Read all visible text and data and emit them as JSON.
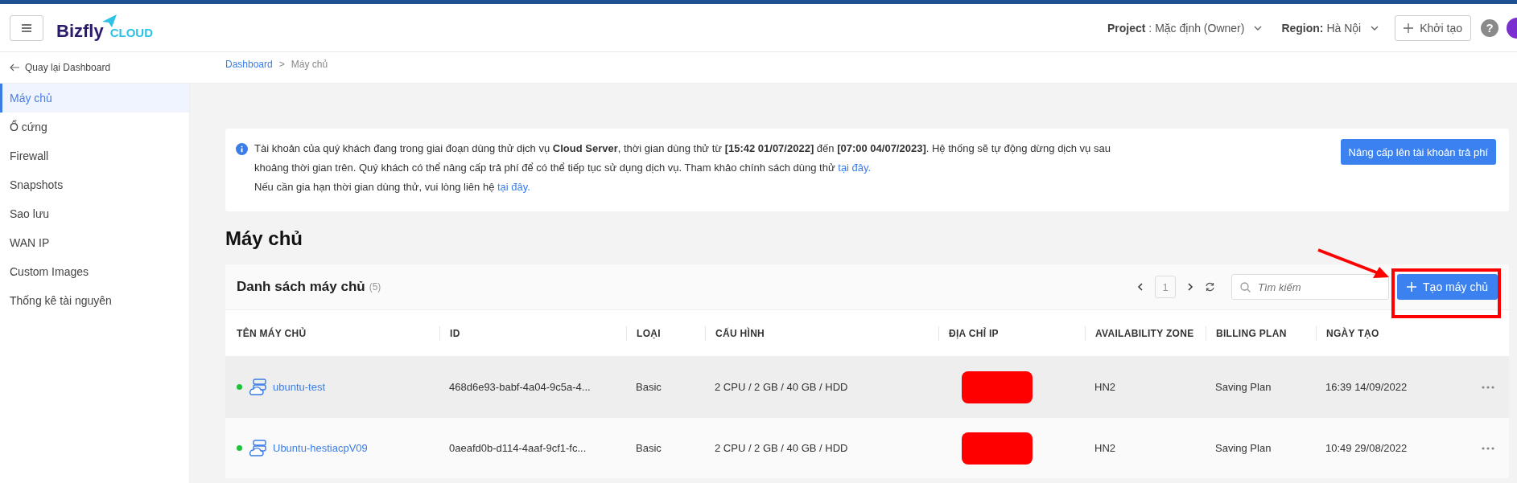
{
  "header": {
    "logo": {
      "name": "Bizfly",
      "suffix": "CLOUD"
    },
    "project_label": "Project",
    "project_value": ": Mặc định (Owner)",
    "region_label": "Region:",
    "region_value": "Hà Nội",
    "create_button": "Khởi tạo",
    "help": "?"
  },
  "sidebar": {
    "back_link": "Quay lại Dashboard",
    "items": [
      {
        "label": "Máy chủ",
        "selected": true
      },
      {
        "label": "Ổ cứng",
        "selected": false
      },
      {
        "label": "Firewall",
        "selected": false
      },
      {
        "label": "Snapshots",
        "selected": false
      },
      {
        "label": "Sao lưu",
        "selected": false
      },
      {
        "label": "WAN IP",
        "selected": false
      },
      {
        "label": "Custom Images",
        "selected": false
      },
      {
        "label": "Thống kê tài nguyên",
        "selected": false
      }
    ]
  },
  "breadcrumb": {
    "items": [
      "Dashboard",
      "Máy chủ"
    ],
    "separator": ">"
  },
  "alert": {
    "paragraphs": [
      {
        "text": "Tài khoản của quý khách đang trong giai đoạn dùng thử dịch vụ **Cloud Server**, thời gian dùng thử từ **[15:42 01/07/2022]** đến **[07:00 04/07/2023]**. Hệ thống sẽ tự động dừng dịch vụ sau khoảng thời gian trên. Quý khách có thể nâng cấp trả phí để có thể tiếp tục sử dụng dịch vụ. Tham khảo chính sách dùng thử ",
        "link": "tại đây."
      },
      {
        "text": "Nếu cần gia hạn thời gian dùng thử, vui lòng liên hệ ",
        "link": "tại đây."
      }
    ],
    "button": "Nâng cấp lên tài khoản trả phí"
  },
  "page_title": "Máy chủ",
  "server_list": {
    "title": "Danh sách máy chủ",
    "count": "(5)",
    "page": "1",
    "search": {
      "placeholder": "Tìm kiếm"
    },
    "create_button": "Tạo máy chủ",
    "columns": [
      "TÊN MÁY CHỦ",
      "ID",
      "LOẠI",
      "CẤU HÌNH",
      "ĐỊA CHỈ IP",
      "AVAILABILITY ZONE",
      "BILLING PLAN",
      "NGÀY TẠO"
    ],
    "rows": [
      {
        "selected": true,
        "color": "#1fc33a",
        "name": "ubuntu-test",
        "id": "468d6e93-babf-4a04-9c5a-4...",
        "type": "Basic",
        "config": "2 CPU / 2 GB / 40 GB / HDD",
        "ip_redacted": true,
        "zone": "HN2",
        "plan": "Saving Plan",
        "created": "16:39 14/09/2022"
      },
      {
        "selected": false,
        "color": "#1fc33a",
        "name": "Ubuntu-hestiacpV09",
        "id": "0aeafd0b-d114-4aaf-9cf1-fc...",
        "type": "Basic",
        "config": "2 CPU / 2 GB / 40 GB / HDD",
        "ip_redacted": true,
        "zone": "HN2",
        "plan": "Saving Plan",
        "created": "10:49 29/08/2022"
      }
    ]
  },
  "annotations": {
    "arrow": true,
    "frame": true
  }
}
